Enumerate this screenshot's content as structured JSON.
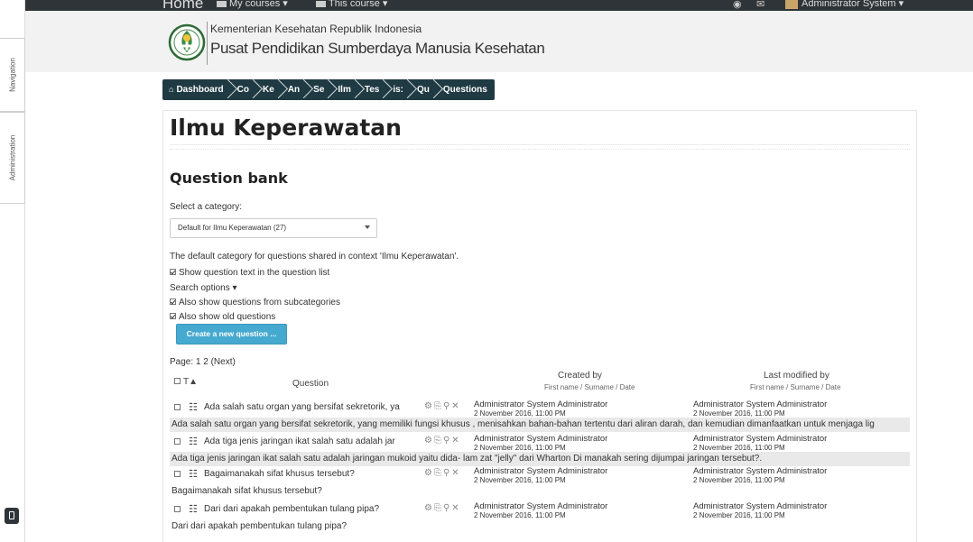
{
  "topbar": {
    "home": "Home",
    "menus": [
      "My courses ▾",
      "This course ▾"
    ],
    "user": "Administrator System ▾"
  },
  "drawer": {
    "navigation": "Navigation",
    "administration": "Administration"
  },
  "header": {
    "line1": "Kementerian Kesehatan Republik Indonesia",
    "line2": "Pusat Pendidikan Sumberdaya Manusia Kesehatan"
  },
  "breadcrumb": [
    "Dashboard",
    "Co",
    "Ke",
    "An",
    "Se",
    "Ilm",
    "Tes",
    "is:",
    "Qu",
    "Questions"
  ],
  "page": {
    "title": "Ilmu Keperawatan",
    "section": "Question bank",
    "select_label": "Select a category:",
    "category_value": "Default for Ilmu Keperawatan (27)",
    "category_note": "The default category for questions shared in context 'Ilmu Keperawatan'.",
    "show_text": "Show question text in the question list",
    "search_options": "Search options ▾",
    "subcategories": "Also show questions from subcategories",
    "old_questions": "Also show old questions",
    "create_button": "Create a new question ...",
    "paging": "Page: 1 2 (Next)"
  },
  "table": {
    "col_t": "T▲",
    "col_question": "Question",
    "created_by": "Created by",
    "created_sub": "First name / Surname / Date",
    "modified_by": "Last modified by",
    "modified_sub": "First name / Surname / Date",
    "rows": [
      {
        "name": "Ada salah satu organ yang bersifat sekretorik, ya",
        "creator": "Administrator System Administrator",
        "created": "2 November 2016, 11:00 PM",
        "modifier": "Administrator System Administrator",
        "modified": "2 November 2016, 11:00 PM",
        "preview": "Ada salah satu organ yang bersifat sekretorik, yang memiliki fungsi khusus , menisahkan bahan-bahan tertentu dari aliran darah, dan kemudian dimanfaatkan untuk menjaga lig"
      },
      {
        "name": "Ada tiga jenis jaringan ikat salah satu adalah jar",
        "creator": "Administrator System Administrator",
        "created": "2 November 2016, 11:00 PM",
        "modifier": "Administrator System Administrator",
        "modified": "2 November 2016, 11:00 PM",
        "preview": "Ada tiga jenis jaringan ikat salah satu adalah jaringan mukoid yaitu dida- lam zat \"jelly\" dari Wharton Di manakah sering dijumpai jaringan tersebut?."
      },
      {
        "name": "Bagaimanakah sifat khusus tersebut?",
        "creator": "Administrator System Administrator",
        "created": "2 November 2016, 11:00 PM",
        "modifier": "Administrator System Administrator",
        "modified": "2 November 2016, 11:00 PM",
        "preview": "Bagaimanakah sifat khusus tersebut?"
      },
      {
        "name": "Dari dari apakah pembentukan tulang pipa?",
        "creator": "Administrator System Administrator",
        "created": "2 November 2016, 11:00 PM",
        "modifier": "Administrator System Administrator",
        "modified": "2 November 2016, 11:00 PM",
        "preview": "Dari dari apakah pembentukan tulang pipa?"
      }
    ]
  },
  "colors": {
    "topbar": "#2f3438",
    "breadcrumb": "#1f3a43",
    "button": "#46a9cf",
    "preview_bg": "#e9e9e9"
  },
  "icons": [
    "bullhorn-icon",
    "envelope-icon",
    "home-icon",
    "multichoice-icon",
    "gear-icon",
    "copy-icon",
    "preview-icon",
    "delete-icon"
  ]
}
